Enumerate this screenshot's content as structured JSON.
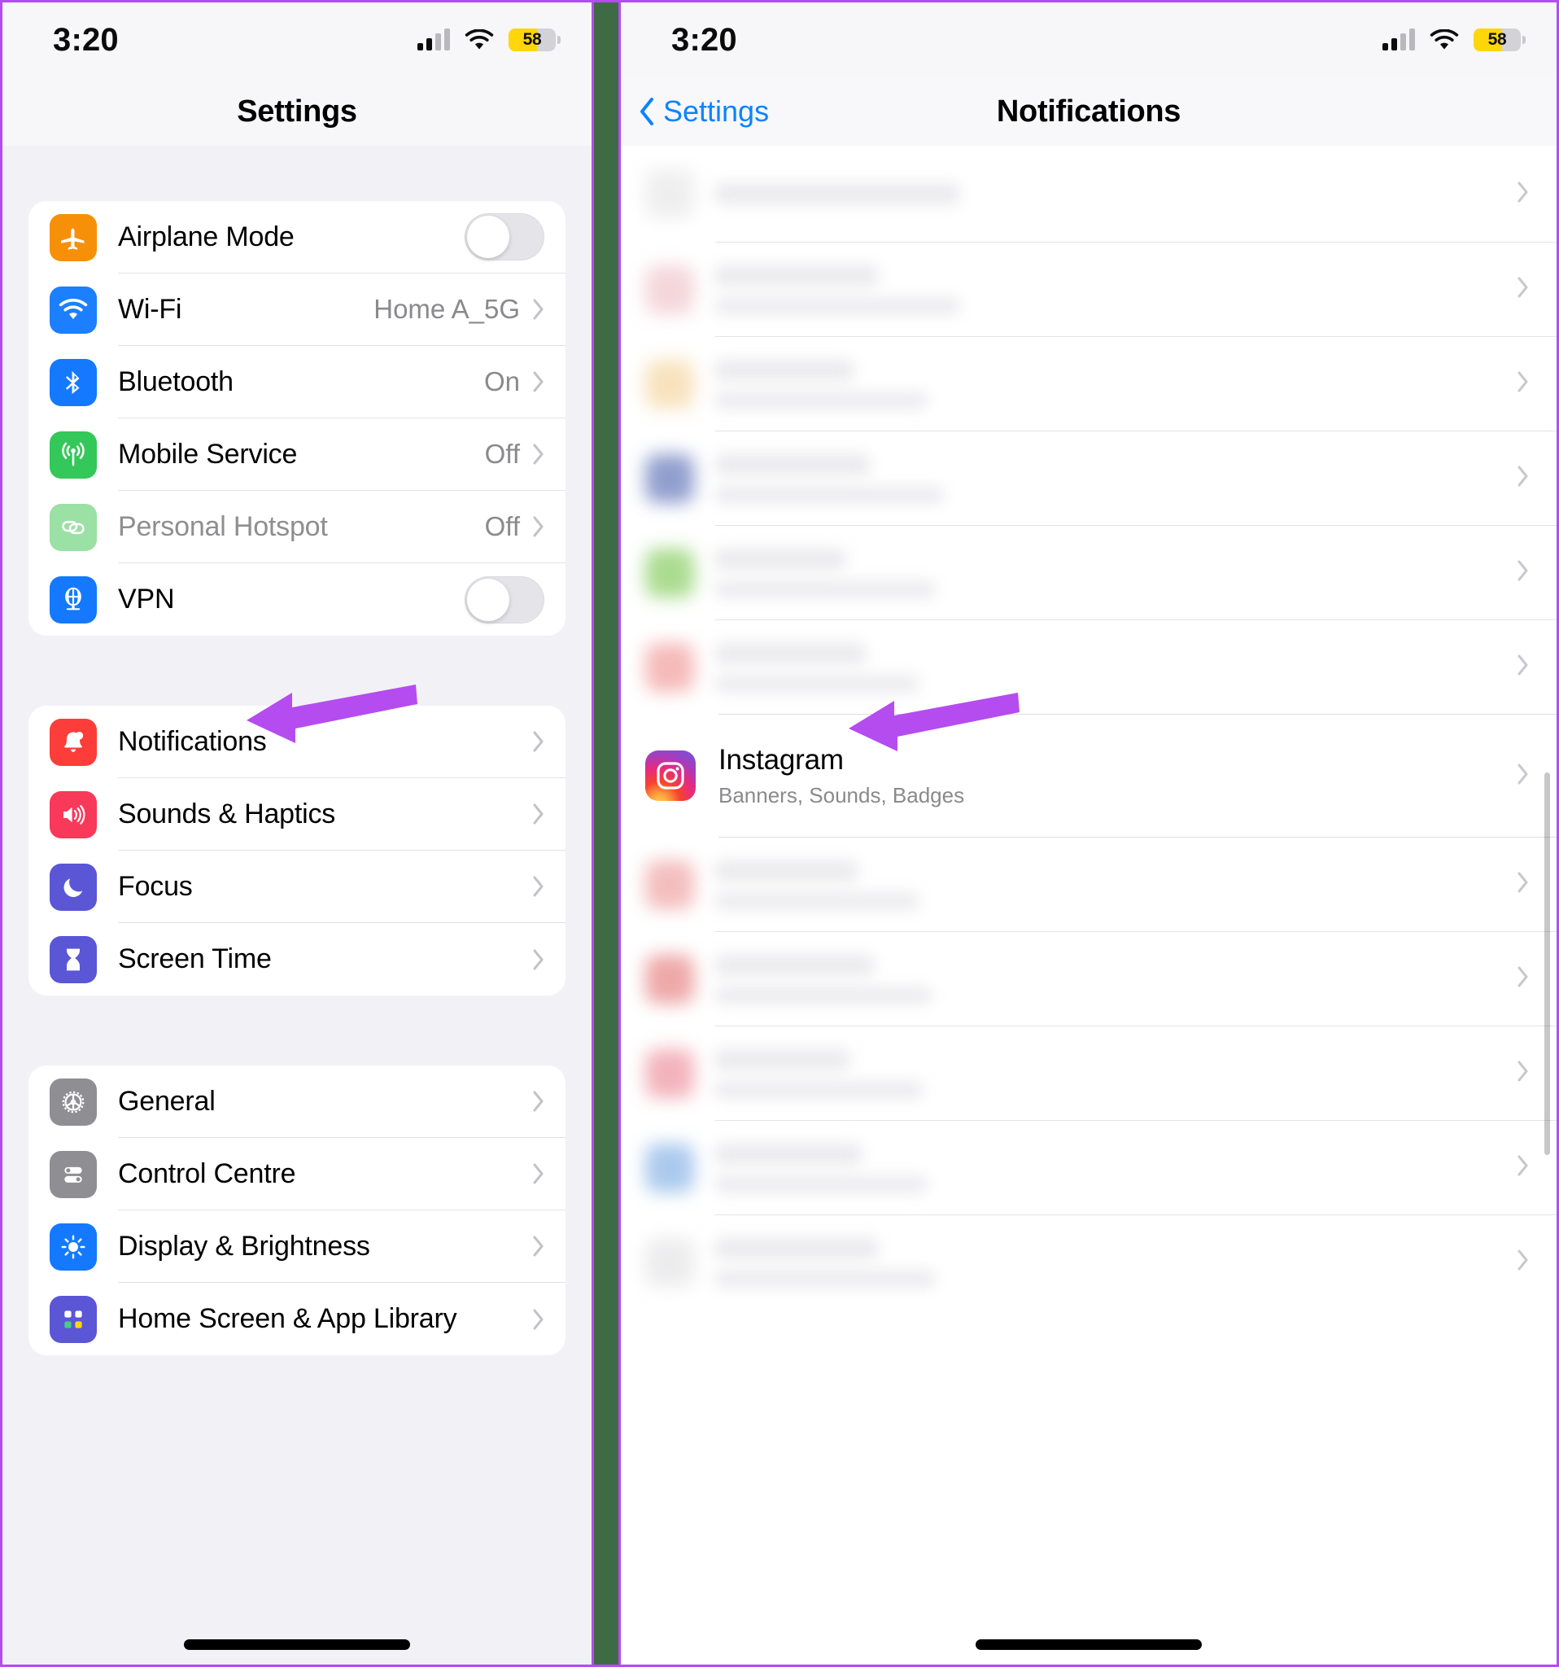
{
  "left_screen": {
    "status_bar": {
      "time": "3:20",
      "battery_level": "58",
      "battery_color": "#ffd60a",
      "signal_icon": "cellular-bars-icon",
      "wifi_icon": "wifi-icon"
    },
    "nav": {
      "title": "Settings"
    },
    "group_connectivity": [
      {
        "label": "Airplane Mode",
        "icon": "airplane-icon",
        "icon_color": "#f79009",
        "control": "toggle",
        "toggle_on": false
      },
      {
        "label": "Wi-Fi",
        "icon": "wifi-icon",
        "icon_color": "#1c7fff",
        "value": "Home A_5G",
        "control": "chevron"
      },
      {
        "label": "Bluetooth",
        "icon": "bluetooth-icon",
        "icon_color": "#1479ff",
        "value": "On",
        "control": "chevron"
      },
      {
        "label": "Mobile Service",
        "icon": "antenna-icon",
        "icon_color": "#34c759",
        "value": "Off",
        "control": "chevron"
      },
      {
        "label": "Personal Hotspot",
        "icon": "link-icon",
        "icon_color": "#9be0a4",
        "value": "Off",
        "control": "chevron",
        "disabled": true
      },
      {
        "label": "VPN",
        "icon": "globe-icon",
        "icon_color": "#1479ff",
        "control": "toggle",
        "toggle_on": false
      }
    ],
    "group_notifications": [
      {
        "label": "Notifications",
        "icon": "bell-badge-icon",
        "icon_color": "#fc3d39",
        "control": "chevron",
        "highlighted": true
      },
      {
        "label": "Sounds & Haptics",
        "icon": "speaker-waves-icon",
        "icon_color": "#f8395a",
        "control": "chevron"
      },
      {
        "label": "Focus",
        "icon": "moon-icon",
        "icon_color": "#5a56d6",
        "control": "chevron"
      },
      {
        "label": "Screen Time",
        "icon": "hourglass-icon",
        "icon_color": "#5a56d6",
        "control": "chevron"
      }
    ],
    "group_system": [
      {
        "label": "General",
        "icon": "gear-icon",
        "icon_color": "#8e8e93",
        "control": "chevron"
      },
      {
        "label": "Control Centre",
        "icon": "sliders-icon",
        "icon_color": "#8e8e93",
        "control": "chevron"
      },
      {
        "label": "Display & Brightness",
        "icon": "sun-icon",
        "icon_color": "#1479ff",
        "control": "chevron"
      },
      {
        "label": "Home Screen & App Library",
        "icon": "app-grid-icon",
        "icon_color": "#5a56d6",
        "control": "chevron",
        "cut_off": true
      }
    ]
  },
  "right_screen": {
    "status_bar": {
      "time": "3:20",
      "battery_level": "58",
      "battery_color": "#ffd60a",
      "signal_icon": "cellular-bars-icon",
      "wifi_icon": "wifi-icon"
    },
    "nav": {
      "back_label": "Settings",
      "back_icon": "chevron-left-icon",
      "title": "Notifications"
    },
    "app_row": {
      "name": "Instagram",
      "subtitle": "Banners, Sounds, Badges",
      "icon": "instagram-icon",
      "highlighted": true
    },
    "blurred_rows_above": 6,
    "blurred_rows_below": 5,
    "blurred_icon_colors": [
      "#e9e9ea",
      "#f1c9cf",
      "#f6d9a8",
      "#6d7fbe",
      "#8ed06a",
      "#f3a3a3",
      "#f0a8a8",
      "#e98b8b",
      "#ef9aa6",
      "#8fb8e8",
      "#e6e6e8"
    ]
  },
  "annotations": {
    "arrow_color": "#b44cf0",
    "arrow_left_target": "Notifications",
    "arrow_right_target": "Instagram"
  },
  "frame": {
    "border_color": "#b44cf0",
    "divider_color": "#3f6b44"
  }
}
